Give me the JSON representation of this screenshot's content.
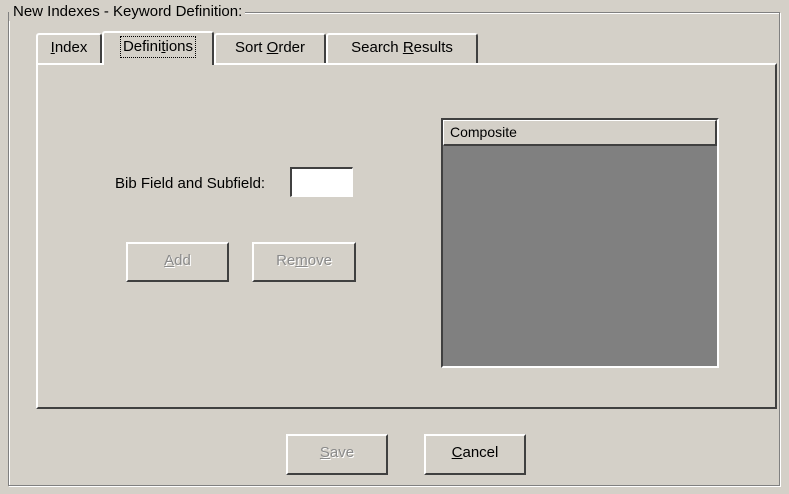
{
  "group_title": "New  Indexes - Keyword Definition:",
  "tabs": [
    {
      "pre": "",
      "mn": "I",
      "post": "ndex",
      "active": false
    },
    {
      "pre": "Defini",
      "mn": "t",
      "post": "ions",
      "active": true
    },
    {
      "pre": "Sort ",
      "mn": "O",
      "post": "rder",
      "active": false
    },
    {
      "pre": "Search ",
      "mn": "R",
      "post": "esults",
      "active": false
    }
  ],
  "field": {
    "label": "Bib Field and Subfield:",
    "value": ""
  },
  "buttons": {
    "add": {
      "pre": "",
      "mn": "A",
      "post": "dd",
      "enabled": false
    },
    "remove": {
      "pre": "Re",
      "mn": "m",
      "post": "ove",
      "enabled": false
    },
    "save": {
      "pre": "",
      "mn": "S",
      "post": "ave",
      "enabled": false
    },
    "cancel": {
      "pre": "",
      "mn": "C",
      "post": "ancel",
      "enabled": true
    }
  },
  "listbox": {
    "column_header": "Composite",
    "items": []
  },
  "colors": {
    "face": "#d4d0c8",
    "list_background": "#808080",
    "disabled_text": "#8a8a8a"
  }
}
